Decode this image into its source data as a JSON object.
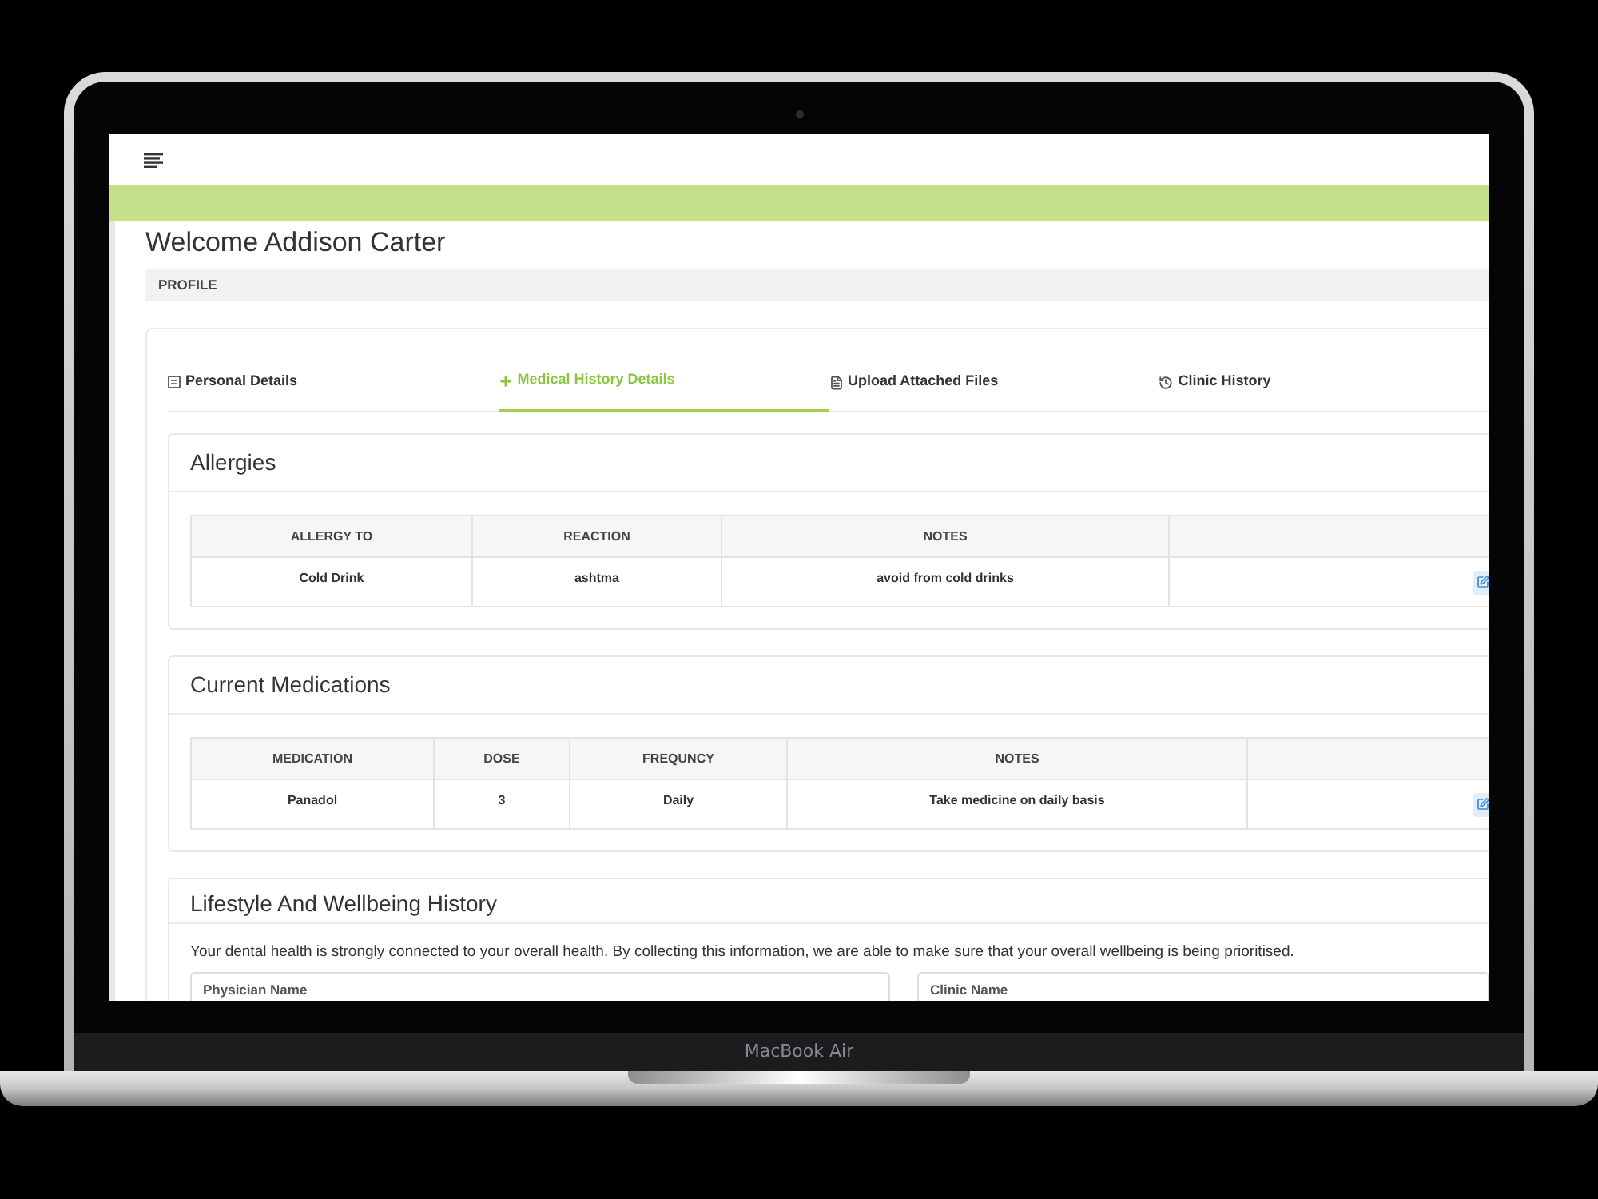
{
  "device": {
    "label": "MacBook Air"
  },
  "page": {
    "title": "Welcome Addison Carter",
    "breadcrumb": "PROFILE"
  },
  "tabs": [
    {
      "label": "Personal Details",
      "selected": false
    },
    {
      "label": "Medical History Details",
      "selected": true
    },
    {
      "label": "Upload Attached Files",
      "selected": false
    },
    {
      "label": "Clinic History",
      "selected": false
    }
  ],
  "sections": [
    {
      "kind": "table",
      "title": "Allergies",
      "columns": [
        "ALLERGY TO",
        "REACTION",
        "NOTES"
      ],
      "rows": [
        [
          "Cold Drink",
          "ashtma",
          "avoid from cold drinks"
        ]
      ]
    },
    {
      "kind": "table",
      "title": "Current Medications",
      "columns": [
        "MEDICATION",
        "DOSE",
        "FREQUNCY",
        "NOTES"
      ],
      "rows": [
        [
          "Panadol",
          "3",
          "Daily",
          "Take medicine on daily basis"
        ]
      ]
    },
    {
      "kind": "form",
      "title": "Lifestyle And Wellbeing History",
      "intro": "Your dental health is strongly connected to your overall health. By collecting this information, we are able to make sure that your overall wellbeing is being prioritised.",
      "fields": [
        {
          "label": "Physician Name"
        },
        {
          "label": "Clinic Name"
        }
      ]
    }
  ]
}
